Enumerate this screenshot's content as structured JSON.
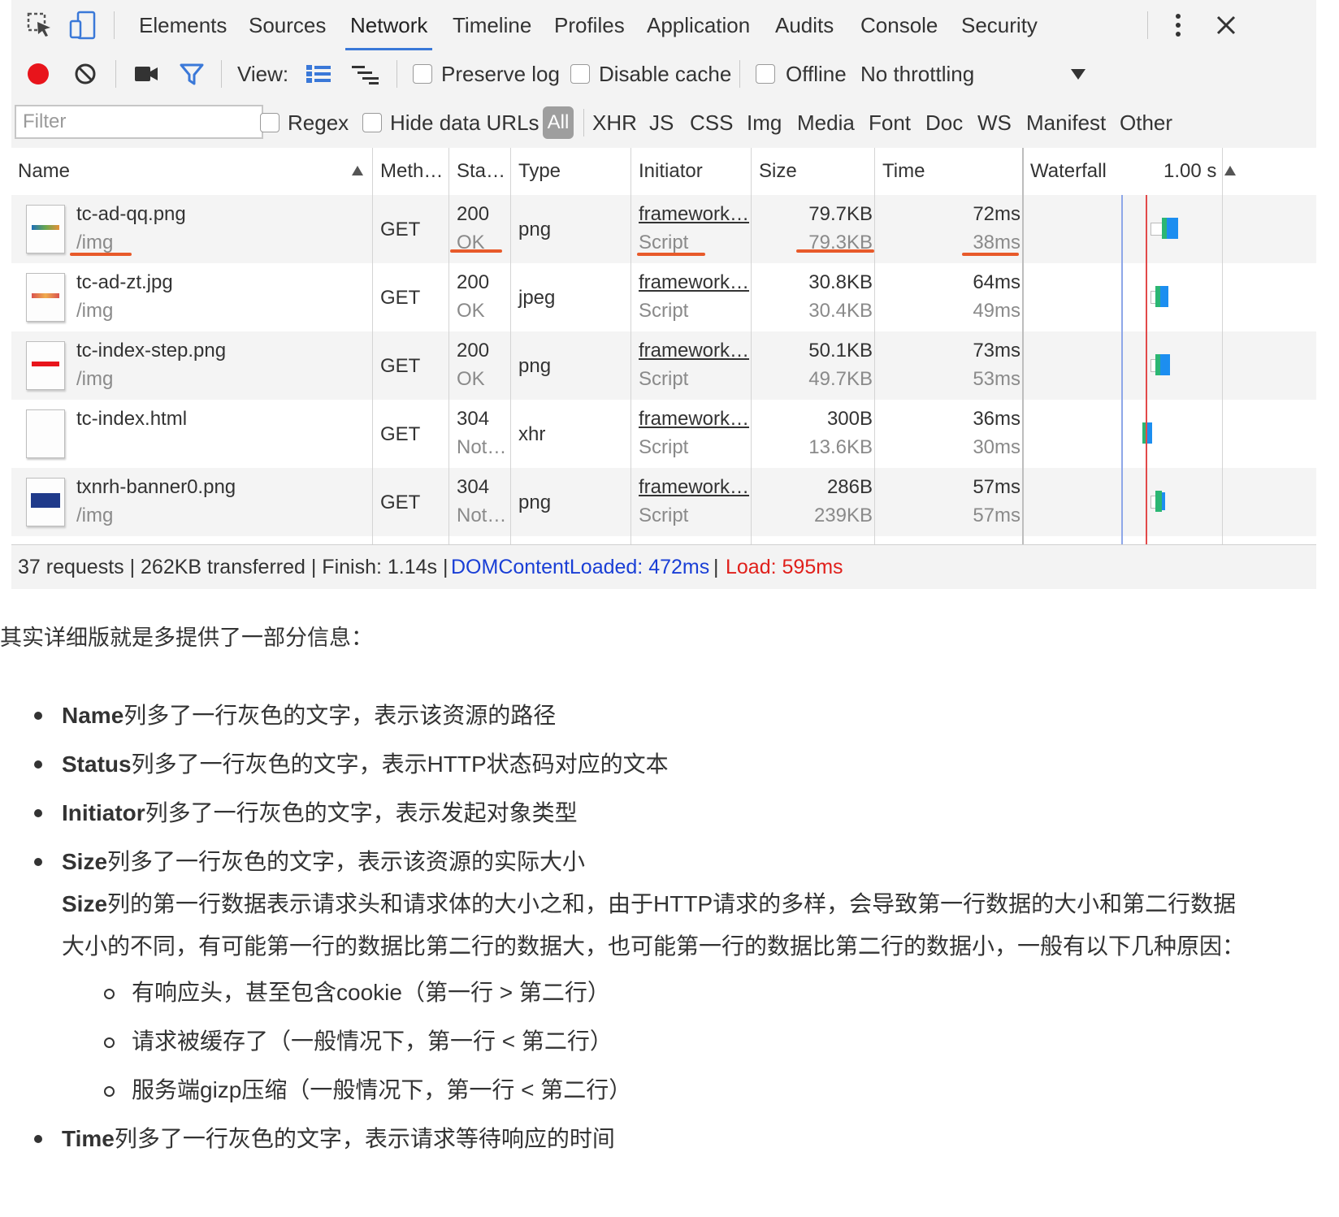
{
  "tabs": [
    "Elements",
    "Sources",
    "Network",
    "Timeline",
    "Profiles",
    "Application",
    "Audits",
    "Console",
    "Security"
  ],
  "active_tab": "Network",
  "toolbar": {
    "view_label": "View:",
    "preserve_log": "Preserve log",
    "disable_cache": "Disable cache",
    "offline": "Offline",
    "throttling": "No throttling"
  },
  "filter": {
    "placeholder": "Filter",
    "regex": "Regex",
    "hide_data_urls": "Hide data URLs",
    "types": [
      "All",
      "XHR",
      "JS",
      "CSS",
      "Img",
      "Media",
      "Font",
      "Doc",
      "WS",
      "Manifest",
      "Other"
    ]
  },
  "columns": {
    "name": "Name",
    "method": "Meth…",
    "status": "Sta…",
    "type": "Type",
    "initiator": "Initiator",
    "size": "Size",
    "time": "Time",
    "waterfall": "Waterfall",
    "waterfall_time": "1.00 s"
  },
  "rows": [
    {
      "name": "tc-ad-qq.png",
      "path": "/img",
      "method": "GET",
      "status": "200",
      "status_text": "OK",
      "type": "png",
      "initiator": "framework…",
      "initiator_type": "Script",
      "size": "79.7KB",
      "size2": "79.3KB",
      "time": "72ms",
      "time2": "38ms"
    },
    {
      "name": "tc-ad-zt.jpg",
      "path": "/img",
      "method": "GET",
      "status": "200",
      "status_text": "OK",
      "type": "jpeg",
      "initiator": "framework…",
      "initiator_type": "Script",
      "size": "30.8KB",
      "size2": "30.4KB",
      "time": "64ms",
      "time2": "49ms"
    },
    {
      "name": "tc-index-step.png",
      "path": "/img",
      "method": "GET",
      "status": "200",
      "status_text": "OK",
      "type": "png",
      "initiator": "framework…",
      "initiator_type": "Script",
      "size": "50.1KB",
      "size2": "49.7KB",
      "time": "73ms",
      "time2": "53ms"
    },
    {
      "name": "tc-index.html",
      "path": "",
      "method": "GET",
      "status": "304",
      "status_text": "Not…",
      "type": "xhr",
      "initiator": "framework…",
      "initiator_type": "Script",
      "size": "300B",
      "size2": "13.6KB",
      "time": "36ms",
      "time2": "30ms"
    },
    {
      "name": "txnrh-banner0.png",
      "path": "/img",
      "method": "GET",
      "status": "304",
      "status_text": "Not…",
      "type": "png",
      "initiator": "framework…",
      "initiator_type": "Script",
      "size": "286B",
      "size2": "239KB",
      "time": "57ms",
      "time2": "57ms"
    }
  ],
  "statusbar": {
    "summary": "37 requests | 262KB transferred | Finish: 1.14s | ",
    "dcl": "DOMContentLoaded: 472ms",
    "sep": " | ",
    "load": "Load: 595ms"
  },
  "article": {
    "intro": "其实详细版就是多提供了一部分信息：",
    "bullets": [
      {
        "term": "Name",
        "text": "列多了一行灰色的文字，表示该资源的路径"
      },
      {
        "term": "Status",
        "text": "列多了一行灰色的文字，表示HTTP状态码对应的文本"
      },
      {
        "term": "Initiator",
        "text": "列多了一行灰色的文字，表示发起对象类型"
      },
      {
        "term": "Size",
        "text": "列多了一行灰色的文字，表示该资源的实际大小"
      }
    ],
    "size_para_term": "Size",
    "size_para_line1": "列的第一行数据表示请求头和请求体的大小之和，由于HTTP请求的多样，会导致第一行数据的大小和第二行数据",
    "size_para_line2": "大小的不同，有可能第一行的数据比第二行的数据大，也可能第一行的数据比第二行的数据小，一般有以下几种原因：",
    "sub_bullets": [
      "有响应头，甚至包含cookie（第一行 > 第二行）",
      "请求被缓存了（一般情况下，第一行 < 第二行）",
      "服务端gizp压缩（一般情况下，第一行 < 第二行）"
    ],
    "last_bullet": {
      "term": "Time",
      "text": "列多了一行灰色的文字，表示请求等待响应的时间"
    }
  },
  "colors": {
    "accent": "#3a78d8",
    "record": "#e8141b",
    "underline": "#e85a2a",
    "dcl": "#1a3fd6",
    "load": "#e0201b"
  }
}
